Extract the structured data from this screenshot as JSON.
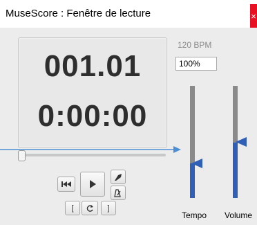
{
  "window": {
    "title": "MuseScore : Fenêtre de lecture",
    "close_label": "×"
  },
  "display": {
    "measure": "001.01",
    "time": "0:00:00"
  },
  "transport": {
    "rewind_icon": "skip-to-start-icon",
    "play_icon": "play-icon",
    "metronome_icon": "metronome-icon",
    "countin_icon": "count-in-icon",
    "loop_in_label": "[",
    "loop_label": "loop-icon",
    "loop_out_label": "]"
  },
  "tempo": {
    "bpm_label": "120 BPM",
    "value": "100%",
    "label": "Tempo",
    "level": 0.18
  },
  "volume": {
    "label": "Volume",
    "level": 0.52
  },
  "position": {
    "level": 0.0
  },
  "colors": {
    "accent": "#2f5fb6",
    "close": "#e81123",
    "annotation": "#4a8fd6"
  }
}
